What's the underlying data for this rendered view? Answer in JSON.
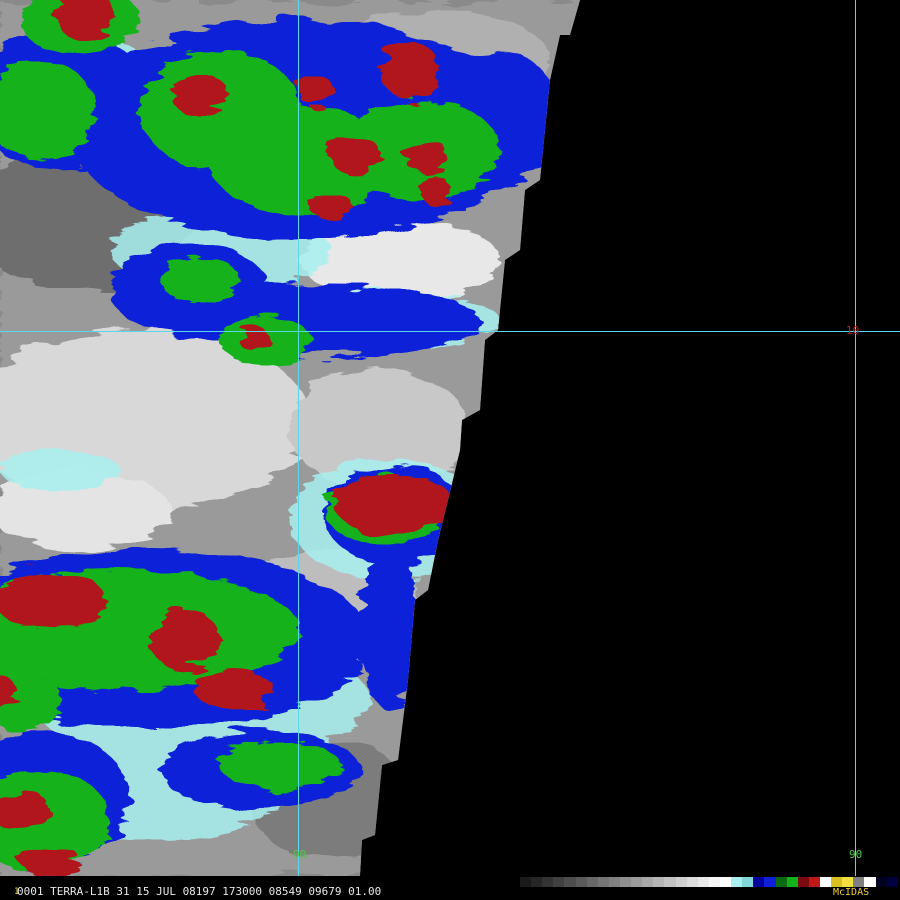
{
  "image": {
    "description_colors": {
      "background": "#000000",
      "grid_line": "#5ad8e8",
      "cold_red": "#b0141a",
      "cold_green": "#12b21a",
      "cold_blue": "#1020d8",
      "cyan_edge": "#a8f0f0"
    }
  },
  "grid_labels": {
    "latitude": "10",
    "longitude_left": "90",
    "longitude_right": "90"
  },
  "info_bar": {
    "frame_number": "1",
    "text": "0001 TERRA-L1B 31 15 JUL 08197 173000 08549 09679 01.00",
    "brand": "McIDAS"
  },
  "color_scale": [
    "#1a1a1a",
    "#262626",
    "#333333",
    "#404040",
    "#4d4d4d",
    "#5a5a5a",
    "#676767",
    "#747474",
    "#818181",
    "#8e8e8e",
    "#9b9b9b",
    "#a8a8a8",
    "#b5b5b5",
    "#c2c2c2",
    "#cfcfcf",
    "#dcdcdc",
    "#e9e9e9",
    "#f6f6f6",
    "#ffffff",
    "#a8f0f0",
    "#80d8d8",
    "#0000a0",
    "#1020d8",
    "#0a6a10",
    "#12b21a",
    "#7a0a10",
    "#c01818",
    "#ffffff",
    "#d8c020",
    "#f0e040",
    "#808080",
    "#ffffff",
    "#000020",
    "#000040"
  ]
}
